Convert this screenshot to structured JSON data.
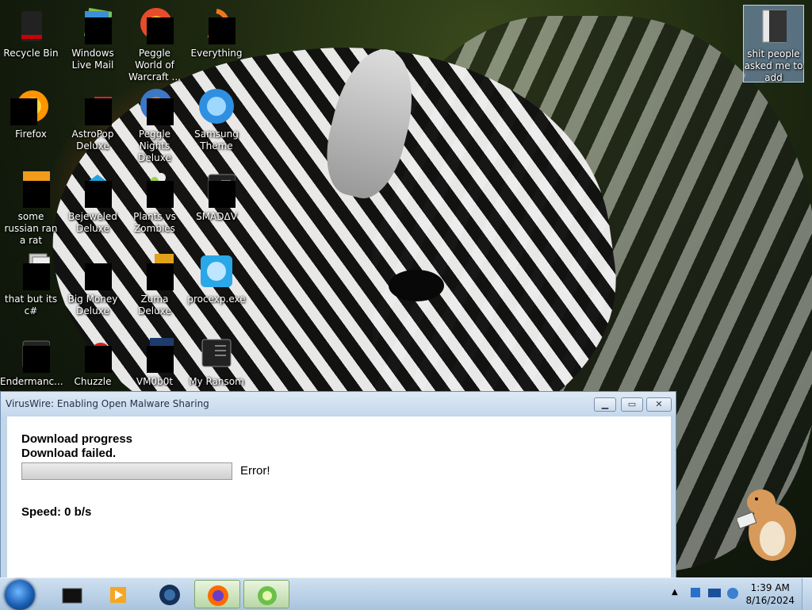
{
  "desktop": {
    "icons": [
      {
        "label": "Recycle Bin",
        "icon": "recycle-bin-icon"
      },
      {
        "label": "Windows Live Mail",
        "icon": "mail-icon"
      },
      {
        "label": "Peggle World of Warcraft ...",
        "icon": "peggle-icon"
      },
      {
        "label": "Everything",
        "icon": "search-app-icon"
      },
      {
        "label": "Firefox",
        "icon": "firefox-icon"
      },
      {
        "label": "AstroPop Deluxe",
        "icon": "game-icon"
      },
      {
        "label": "Peggle Nights Deluxe",
        "icon": "peggle-icon"
      },
      {
        "label": "Samsung Theme",
        "icon": "theme-icon"
      },
      {
        "label": "some russian ran a rat",
        "icon": "app-icon"
      },
      {
        "label": "Bejeweled Deluxe",
        "icon": "gem-icon"
      },
      {
        "label": "Plants vs Zombies",
        "icon": "plant-icon"
      },
      {
        "label": "SMADΔV",
        "icon": "document-icon"
      },
      {
        "label": "that but its c#",
        "icon": "stack-icon"
      },
      {
        "label": "Big Money Deluxe",
        "icon": "game-icon"
      },
      {
        "label": "Zuma Deluxe",
        "icon": "game-icon"
      },
      {
        "label": "procexp.exe",
        "icon": "process-explorer-icon"
      },
      {
        "label": "Endermanc...",
        "icon": "document-icon"
      },
      {
        "label": "Chuzzle",
        "icon": "game-icon"
      },
      {
        "label": "VM0b0t",
        "icon": "vm-icon"
      },
      {
        "label": "My Ransom",
        "icon": "document-icon"
      }
    ],
    "folder": {
      "label": "shit people asked me to add",
      "icon": "folder-icon"
    }
  },
  "window": {
    "title": "VirusWire: Enabling Open Malware Sharing",
    "heading": "Download progress",
    "status": "Download failed.",
    "error_label": "Error!",
    "speed": "Speed: 0 b/s",
    "progress_fraction": 0.0
  },
  "taskbar": {
    "time": "1:39 AM",
    "date": "8/16/2024",
    "apps": [
      {
        "icon": "cmd-icon",
        "active": false
      },
      {
        "icon": "media-player-icon",
        "active": false
      },
      {
        "icon": "globe-icon",
        "active": false
      },
      {
        "icon": "firefox-icon",
        "active": true
      },
      {
        "icon": "virus-wire-icon",
        "active": true
      }
    ]
  },
  "colors": {
    "taskbar": "#a9c4de",
    "window_frame": "#c2d6ea",
    "progress": "#3cb043"
  }
}
